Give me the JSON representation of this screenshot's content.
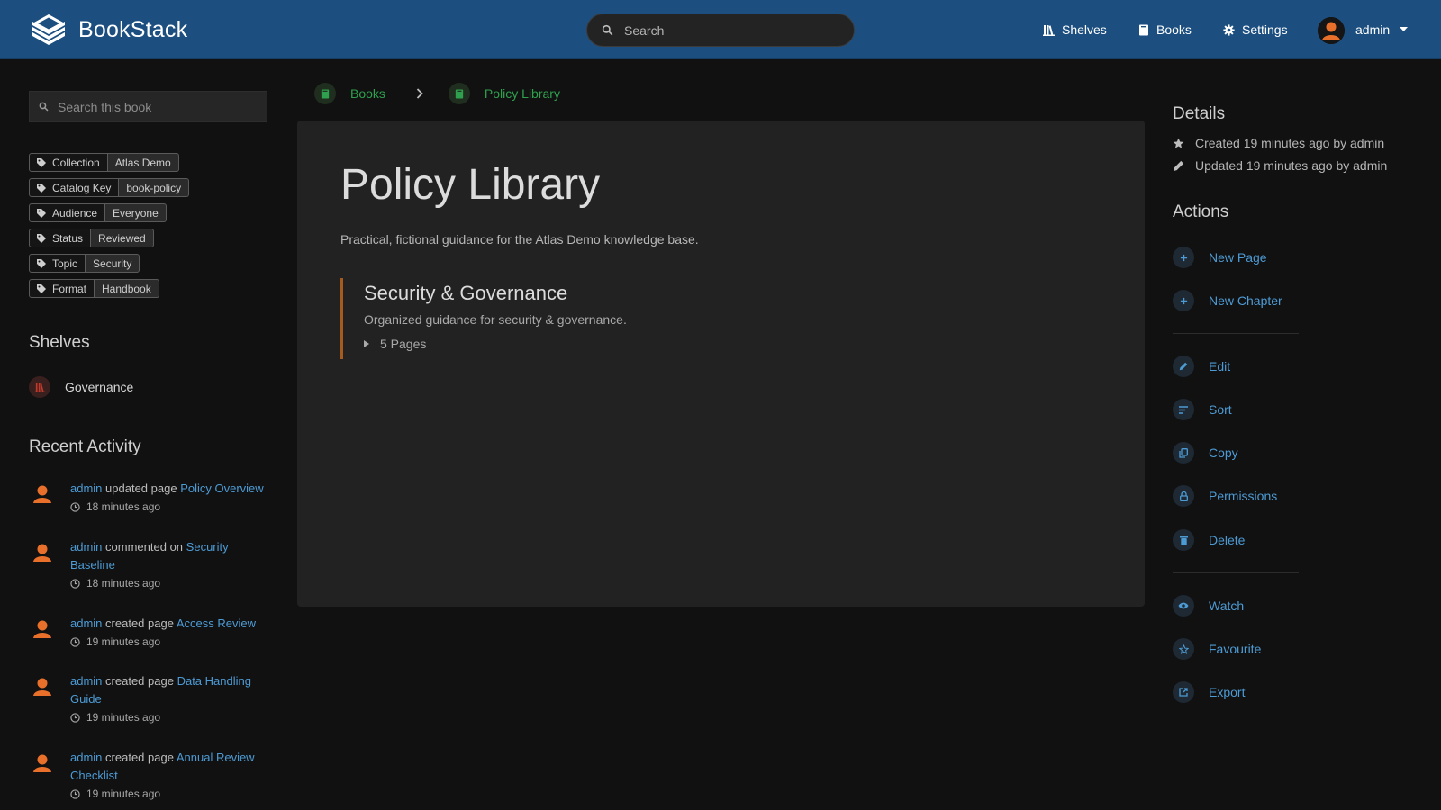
{
  "app": {
    "name": "BookStack"
  },
  "header": {
    "search_placeholder": "Search",
    "nav": [
      {
        "label": "Shelves",
        "icon": "shelves-icon"
      },
      {
        "label": "Books",
        "icon": "book-icon"
      },
      {
        "label": "Settings",
        "icon": "gear-icon"
      }
    ],
    "user": {
      "name": "admin"
    }
  },
  "left": {
    "book_search_placeholder": "Search this book",
    "tags": [
      {
        "name": "Collection",
        "value": "Atlas Demo"
      },
      {
        "name": "Catalog Key",
        "value": "book-policy"
      },
      {
        "name": "Audience",
        "value": "Everyone"
      },
      {
        "name": "Status",
        "value": "Reviewed"
      },
      {
        "name": "Topic",
        "value": "Security"
      },
      {
        "name": "Format",
        "value": "Handbook"
      }
    ],
    "shelves_heading": "Shelves",
    "shelves": [
      {
        "label": "Governance"
      }
    ],
    "activity_heading": "Recent Activity",
    "activity": [
      {
        "user": "admin",
        "action": "updated page",
        "target": "Policy Overview",
        "time": "18 minutes ago"
      },
      {
        "user": "admin",
        "action": "commented on",
        "target": "Security Baseline",
        "time": "18 minutes ago"
      },
      {
        "user": "admin",
        "action": "created page",
        "target": "Access Review",
        "time": "19 minutes ago"
      },
      {
        "user": "admin",
        "action": "created page",
        "target": "Data Handling Guide",
        "time": "19 minutes ago"
      },
      {
        "user": "admin",
        "action": "created page",
        "target": "Annual Review Checklist",
        "time": "19 minutes ago"
      }
    ]
  },
  "breadcrumb": [
    {
      "label": "Books"
    },
    {
      "label": "Policy Library"
    }
  ],
  "main": {
    "title": "Policy Library",
    "description": "Practical, fictional guidance for the Atlas Demo knowledge base.",
    "chapters": [
      {
        "title": "Security & Governance",
        "description": "Organized guidance for security & governance.",
        "pages_label": "5 Pages"
      }
    ]
  },
  "right": {
    "details_heading": "Details",
    "details": [
      {
        "icon": "star-icon",
        "text": "Created 19 minutes ago by admin"
      },
      {
        "icon": "pencil-icon",
        "text": "Updated 19 minutes ago by admin"
      }
    ],
    "actions_heading": "Actions",
    "actions": [
      {
        "label": "New Page",
        "icon": "plus-icon"
      },
      {
        "label": "New Chapter",
        "icon": "plus-icon"
      },
      {
        "label": "Edit",
        "icon": "edit-icon"
      },
      {
        "label": "Sort",
        "icon": "sort-icon"
      },
      {
        "label": "Copy",
        "icon": "copy-icon"
      },
      {
        "label": "Permissions",
        "icon": "lock-icon"
      },
      {
        "label": "Delete",
        "icon": "trash-icon"
      },
      {
        "label": "Watch",
        "icon": "eye-icon"
      },
      {
        "label": "Favourite",
        "icon": "star-outline-icon"
      },
      {
        "label": "Export",
        "icon": "export-icon"
      }
    ]
  },
  "colors": {
    "header": "#1c4f80",
    "background": "#111111",
    "card": "#222222",
    "link": "#4d9bd5",
    "book": "#2fa04e",
    "chapter_accent": "#a55a1e",
    "avatar": "#e8702a"
  }
}
